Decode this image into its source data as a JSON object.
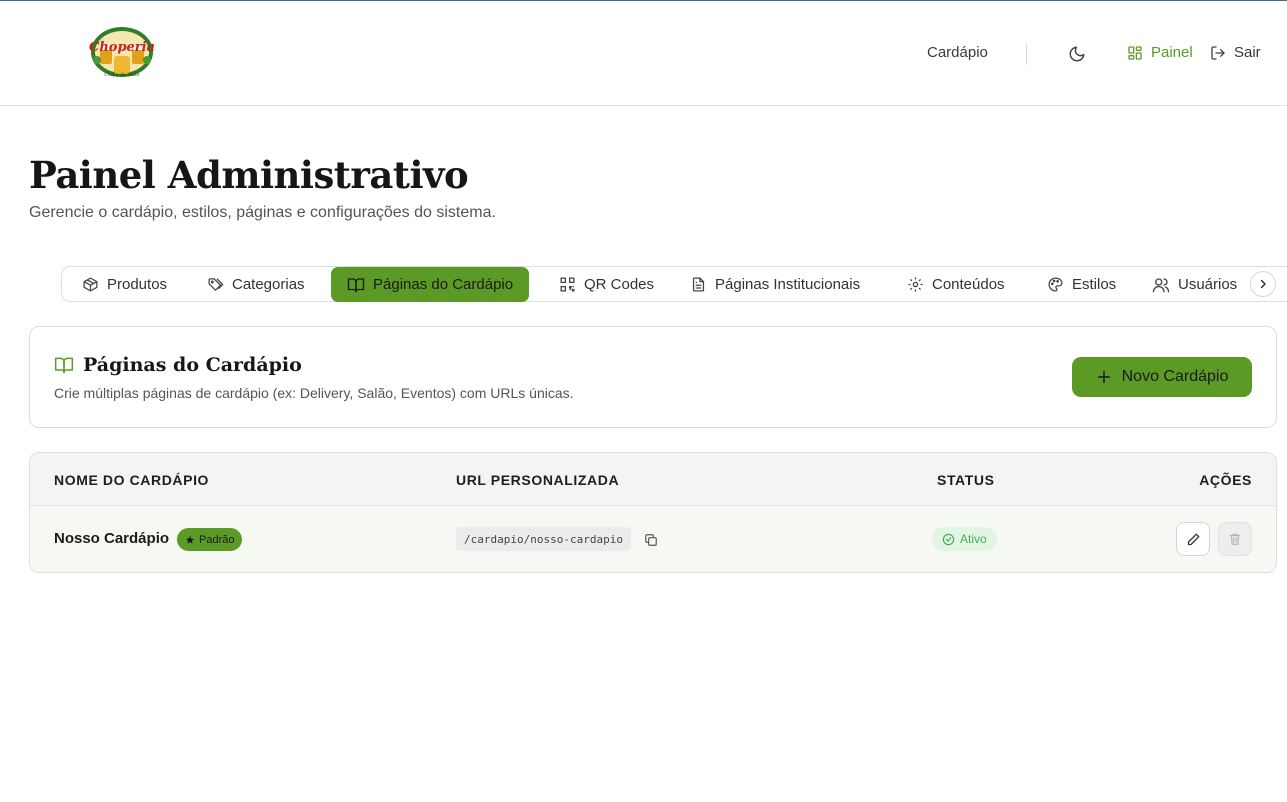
{
  "header": {
    "logo_text": "Choperia",
    "logo_subtext": "Chopp de Malte",
    "nav_cardapio": "Cardápio",
    "nav_painel": "Painel",
    "nav_sair": "Sair"
  },
  "page": {
    "title": "Painel Administrativo",
    "subtitle": "Gerencie o cardápio, estilos, páginas e configurações do sistema."
  },
  "tabs": [
    {
      "label": "Produtos",
      "icon": "package-icon"
    },
    {
      "label": "Categorias",
      "icon": "tags-icon"
    },
    {
      "label": "Páginas do Cardápio",
      "icon": "book-open-icon",
      "active": true
    },
    {
      "label": "QR Codes",
      "icon": "qr-code-icon"
    },
    {
      "label": "Páginas Institucionais",
      "icon": "file-text-icon"
    },
    {
      "label": "Conteúdos",
      "icon": "gear-icon"
    },
    {
      "label": "Estilos",
      "icon": "palette-icon"
    },
    {
      "label": "Usuários",
      "icon": "users-icon"
    }
  ],
  "card": {
    "title": "Páginas do Cardápio",
    "description": "Crie múltiplas páginas de cardápio (ex: Delivery, Salão, Eventos) com URLs únicas.",
    "new_button": "Novo Cardápio"
  },
  "table": {
    "headers": {
      "name": "NOME DO CARDÁPIO",
      "url": "URL PERSONALIZADA",
      "status": "STATUS",
      "actions": "AÇÕES"
    },
    "rows": [
      {
        "name": "Nosso Cardápio",
        "badge": "Padrão",
        "url": "/cardapio/nosso-cardapio",
        "status": "Ativo"
      }
    ]
  },
  "colors": {
    "accent": "#5a9a25",
    "status_bg": "#e2f5e5",
    "status_text": "#3fae55"
  }
}
